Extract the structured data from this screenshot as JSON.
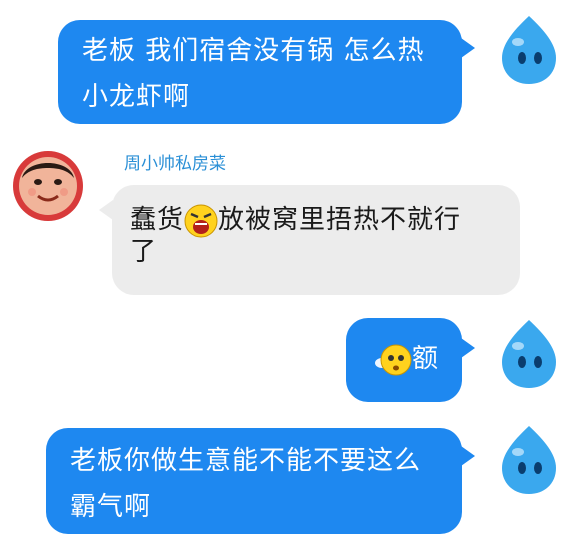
{
  "messages": [
    {
      "direction": "outgoing",
      "lines": [
        "老板 我们宿舍没有锅 怎么热",
        "小龙虾啊"
      ]
    },
    {
      "direction": "incoming",
      "sender": "周小帅私房菜",
      "line1_before_emoji": "蠢货",
      "line1_emoji": "laughing-face",
      "line1_after_emoji": "放被窝里捂热不就行",
      "line2": "了"
    },
    {
      "direction": "outgoing",
      "emoji": "sweat-face",
      "text": "额"
    },
    {
      "direction": "outgoing",
      "lines": [
        "老板你做生意能不能不要这么",
        "霸气啊"
      ]
    }
  ],
  "colors": {
    "outgoing_bubble": "#1e88f0",
    "incoming_bubble": "#ececec",
    "sender_name": "#2a8fd6",
    "qq_avatar": "#3aa8ee"
  }
}
